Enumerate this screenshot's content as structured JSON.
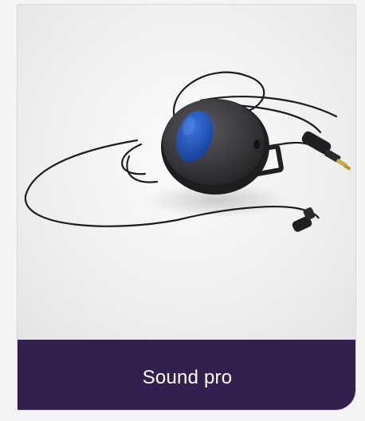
{
  "product": {
    "name": "Sound pro",
    "image_icon": "switch-with-cable",
    "caption_color": "#33204f",
    "button_color": "#1f4fb0"
  }
}
